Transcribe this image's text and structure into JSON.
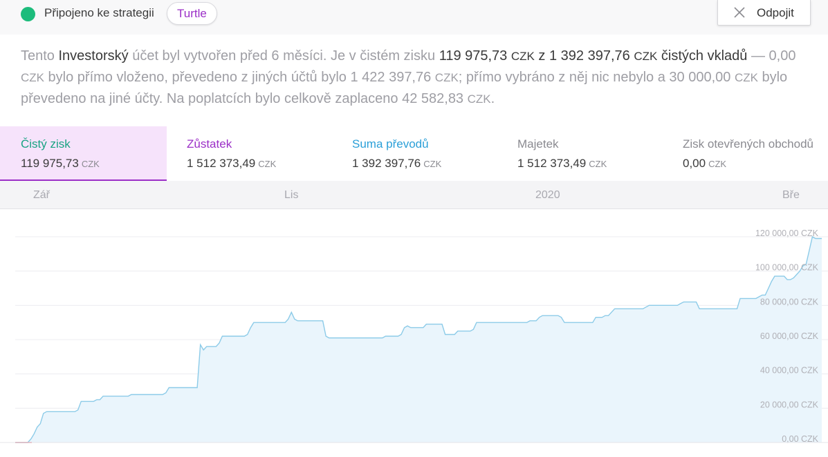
{
  "header": {
    "status_label": "Připojeno ke strategii",
    "strategy_name": "Turtle",
    "disconnect_label": "Odpojit",
    "icons": {
      "status": "status-dot",
      "disconnect": "close-icon"
    },
    "colors": {
      "status": "#1dbc7c",
      "strategy": "#9b2fc7"
    }
  },
  "summary": {
    "p1": "Tento ",
    "account_type": "Investorský",
    "p2": " účet byl vytvořen před 6 měsíci. Je v čistém zisku ",
    "profit": "119 975,73",
    "profit_unit": "CZK",
    "p3": " z ",
    "net_deposits": "1 392 397,76",
    "net_deposits_unit": "CZK",
    "p4": " čistých vkladů",
    "p5": " — 0,00 ",
    "deposit_unit": "CZK",
    "p6": " bylo přímo vloženo, převedeno z jiných účtů bylo 1 422 397,76 ",
    "transfer_in_unit": "CZK",
    "p7": "; přímo vybráno z něj nic nebylo a 30 000,00 ",
    "transfer_out_unit": "CZK",
    "p8": " bylo převedeno na jiné účty. Na poplatcích bylo celkově zaplaceno 42 582,83 ",
    "fees_unit": "CZK",
    "p9": "."
  },
  "tabs": [
    {
      "label": "Čistý zisk",
      "value": "119 975,73",
      "unit": "CZK",
      "color": "#19a383"
    },
    {
      "label": "Zůstatek",
      "value": "1 512 373,49",
      "unit": "CZK",
      "color": "#9b2fc7"
    },
    {
      "label": "Suma převodů",
      "value": "1 392 397,76",
      "unit": "CZK",
      "color": "#2a9fd8"
    },
    {
      "label": "Majetek",
      "value": "1 512 373,49",
      "unit": "CZK",
      "color": "#8a8a90"
    },
    {
      "label": "Zisk otevřených obchodů",
      "value": "0,00",
      "unit": "CZK",
      "color": "#8a8a90"
    }
  ],
  "chart_data": {
    "type": "area",
    "x_tick_labels": [
      "Zář",
      "Lis",
      "2020",
      "Bře"
    ],
    "y_tick_labels": [
      "120 000,00 CZK",
      "100 000,00 CZK",
      "80 000,00 CZK",
      "60 000,00 CZK",
      "40 000,00 CZK",
      "20 000,00 CZK",
      "0,00 CZK"
    ],
    "y_ticks": [
      120000,
      100000,
      80000,
      60000,
      40000,
      20000,
      0
    ],
    "ylim": [
      0,
      130000
    ],
    "grid": true,
    "line_color": "#8ccbe8",
    "fill_color": "#eaf5fc",
    "series": [
      {
        "values": [
          0,
          0,
          0,
          0,
          0,
          2000,
          5000,
          9000,
          11000,
          17000,
          18000,
          18000,
          18000,
          18000,
          18000,
          18000,
          18000,
          18000,
          18000,
          18000,
          19000,
          24000,
          24000,
          24000,
          24000,
          24000,
          25000,
          25000,
          27000,
          27000,
          27000,
          27000,
          27000,
          27000,
          27000,
          27000,
          27000,
          28000,
          28000,
          28000,
          28000,
          28000,
          28000,
          28000,
          28000,
          28000,
          28000,
          28000,
          29000,
          32000,
          32000,
          32000,
          32000,
          32000,
          32000,
          32000,
          32000,
          32000,
          32000,
          57000,
          54000,
          56000,
          56000,
          56000,
          56000,
          58000,
          62000,
          62000,
          62000,
          62000,
          62000,
          62000,
          62000,
          62000,
          63000,
          67000,
          70000,
          70000,
          70000,
          70000,
          70000,
          70000,
          70000,
          70000,
          70000,
          70000,
          70000,
          72000,
          76000,
          72000,
          71000,
          71000,
          71000,
          71000,
          71000,
          71000,
          71000,
          71000,
          71000,
          62000,
          61000,
          61000,
          61000,
          61000,
          61000,
          61000,
          61000,
          61000,
          61000,
          61000,
          61000,
          61000,
          61000,
          61000,
          61000,
          61000,
          61000,
          61000,
          62000,
          62000,
          62000,
          62000,
          62000,
          63000,
          67000,
          68000,
          67000,
          67000,
          67000,
          67000,
          67000,
          69000,
          69000,
          69000,
          69000,
          69000,
          69000,
          63000,
          63000,
          63000,
          63000,
          65000,
          65000,
          65000,
          65000,
          65000,
          66000,
          70000,
          70000,
          70000,
          70000,
          70000,
          70000,
          70000,
          70000,
          70000,
          70000,
          70000,
          70000,
          70000,
          70000,
          70000,
          70000,
          70000,
          71000,
          71000,
          71000,
          73000,
          74000,
          74000,
          74000,
          74000,
          74000,
          74000,
          73000,
          70000,
          70000,
          70000,
          70000,
          70000,
          70000,
          70000,
          70000,
          70000,
          70000,
          73000,
          73000,
          73000,
          74000,
          74000,
          76000,
          78000,
          78000,
          78000,
          78000,
          78000,
          78000,
          78000,
          78000,
          78000,
          78000,
          79000,
          80000,
          80000,
          80000,
          80000,
          80000,
          80000,
          80000,
          80000,
          80000,
          80000,
          81000,
          82000,
          82000,
          82000,
          82000,
          82000,
          78000,
          78000,
          78000,
          78000,
          78000,
          78000,
          78000,
          78000,
          78000,
          78000,
          78000,
          78000,
          78000,
          84000,
          84000,
          84000,
          84000,
          84000,
          84000,
          85000,
          86000,
          86000,
          90000,
          94000,
          97000,
          97000,
          97000,
          97000,
          95000,
          95000,
          96000,
          98000,
          100000,
          103000,
          104000,
          112000,
          120000,
          119000,
          119000,
          119000
        ]
      }
    ]
  }
}
